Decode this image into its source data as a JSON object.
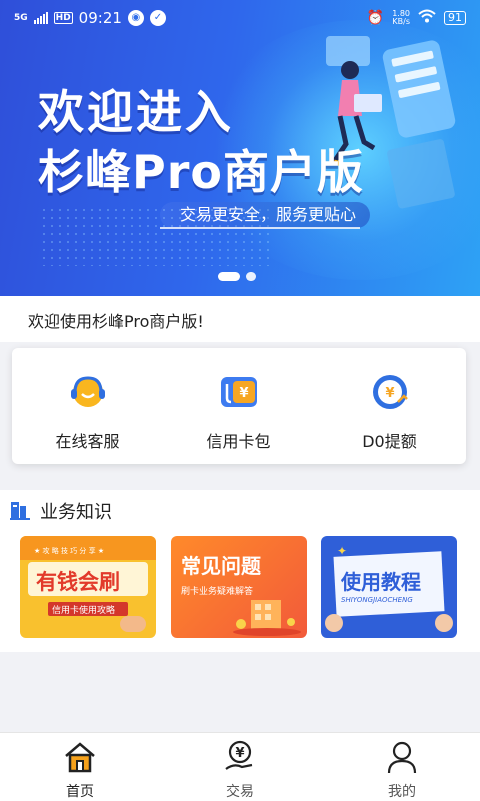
{
  "status_bar": {
    "network": "5G",
    "hd": "HD",
    "time": "09:21",
    "speed_value": "1.80",
    "speed_unit": "KB/s",
    "battery": "91"
  },
  "banner": {
    "title_line1": "欢迎进入",
    "title_line2": "杉峰Pro商户版",
    "subtitle": "交易更安全，服务更贴心"
  },
  "welcome": {
    "text": "欢迎使用杉峰Pro商户版!"
  },
  "services": [
    {
      "label": "在线客服",
      "icon": "customer-service-icon"
    },
    {
      "label": "信用卡包",
      "icon": "card-wallet-icon"
    },
    {
      "label": "D0提额",
      "icon": "limit-increase-icon"
    }
  ],
  "knowledge": {
    "title": "业务知识",
    "cards": [
      {
        "title": "有钱会刷",
        "subtitle": "信用卡使用攻略",
        "ribbon": "★ 攻 略 技 巧 分 享 ★"
      },
      {
        "title": "常见问题",
        "subtitle": "刷卡业务疑难解答"
      },
      {
        "title": "使用教程",
        "subtitle": "SHIYONGJIAOCHENG"
      }
    ]
  },
  "tabbar": {
    "tabs": [
      {
        "label": "首页",
        "icon": "home-icon"
      },
      {
        "label": "交易",
        "icon": "transaction-icon"
      },
      {
        "label": "我的",
        "icon": "profile-icon"
      }
    ]
  },
  "colors": {
    "banner_start": "#2f4fd9",
    "banner_end": "#2ea2f5",
    "accent_orange": "#f7a21b",
    "card_blue": "#2f5fd8"
  }
}
